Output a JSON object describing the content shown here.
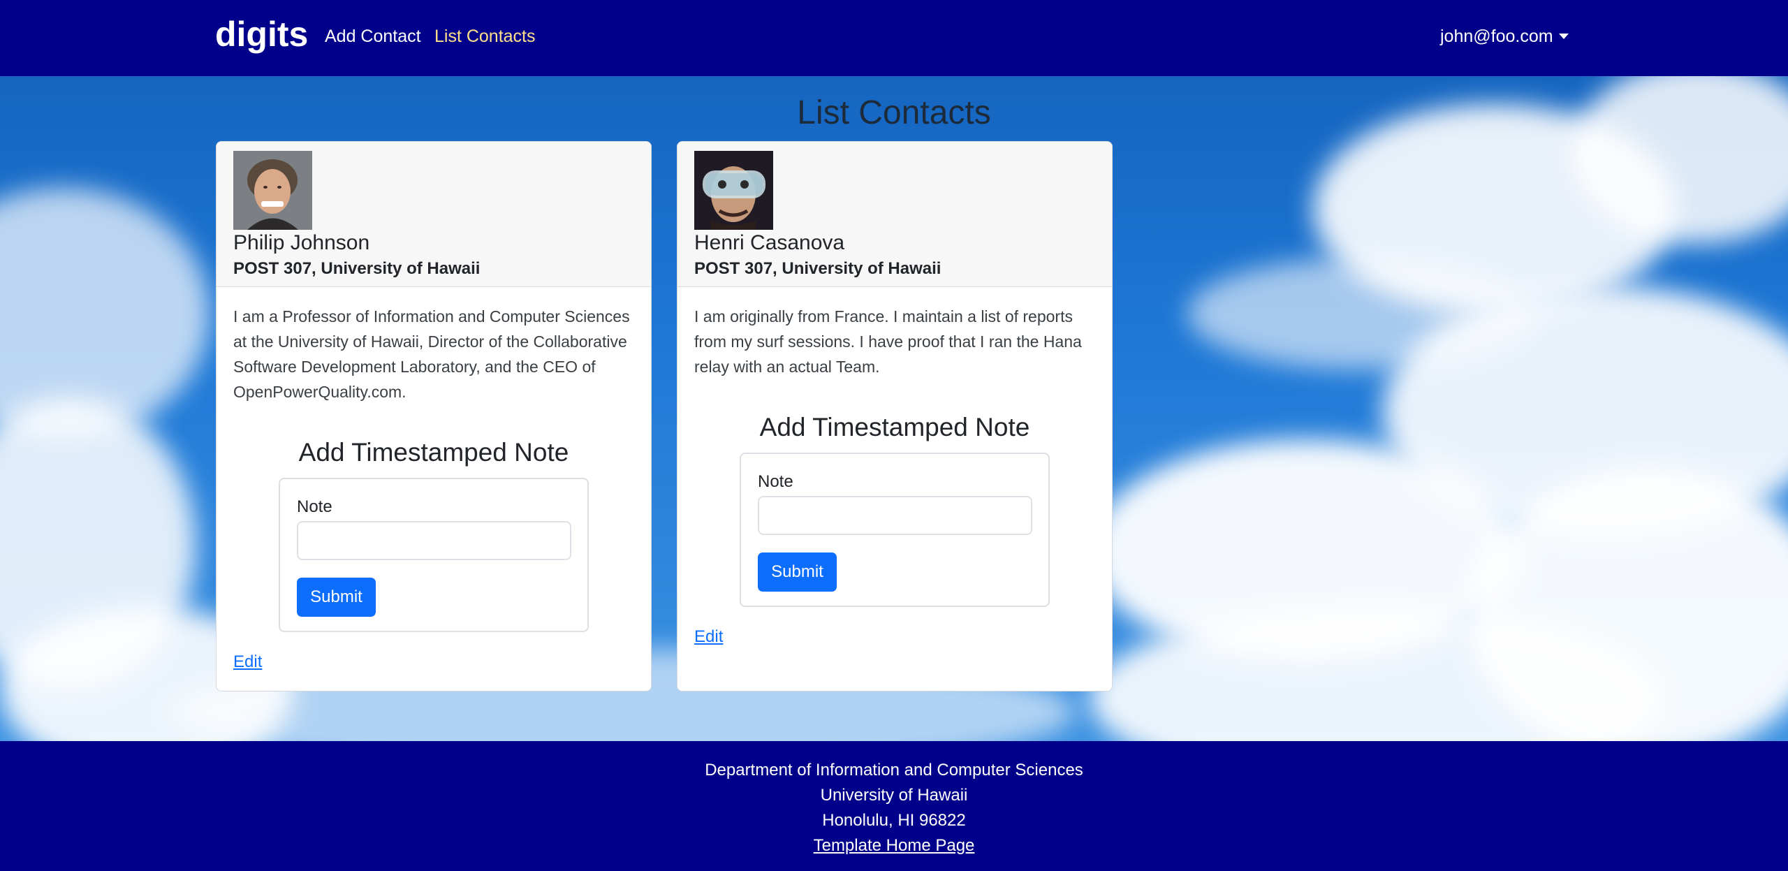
{
  "navbar": {
    "brand": "digits",
    "links": [
      {
        "label": "Add Contact"
      },
      {
        "label": "List Contacts"
      }
    ],
    "user": "john@foo.com"
  },
  "page": {
    "title": "List Contacts"
  },
  "contacts": [
    {
      "name": "Philip Johnson",
      "address": "POST 307, University of Hawaii",
      "description": "I am a Professor of Information and Computer Sciences at the University of Hawaii, Director of the Collaborative Software Development Laboratory, and the CEO of OpenPowerQuality.com.",
      "note_section": {
        "title": "Add Timestamped Note",
        "label": "Note",
        "value": "",
        "submit": "Submit"
      },
      "edit": "Edit"
    },
    {
      "name": "Henri Casanova",
      "address": "POST 307, University of Hawaii",
      "description": "I am originally from France. I maintain a list of reports from my surf sessions. I have proof that I ran the Hana relay with an actual Team.",
      "note_section": {
        "title": "Add Timestamped Note",
        "label": "Note",
        "value": "",
        "submit": "Submit"
      },
      "edit": "Edit"
    }
  ],
  "footer": {
    "line1": "Department of Information and Computer Sciences",
    "line2": "University of Hawaii",
    "line3": "Honolulu, HI 96822",
    "link": "Template Home Page"
  },
  "colors": {
    "navbar": "#00008b",
    "active_link": "#ffe08a",
    "button": "#0d6efd"
  }
}
